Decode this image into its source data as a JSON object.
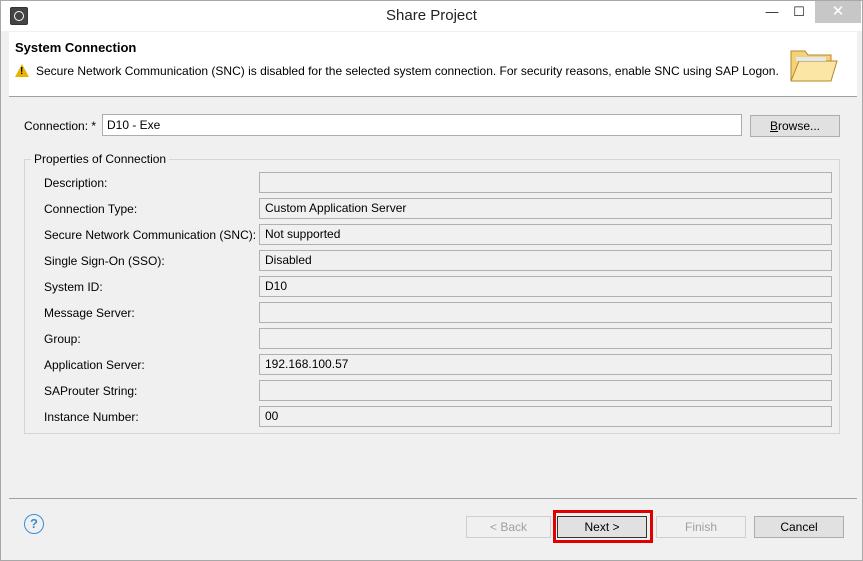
{
  "window": {
    "title": "Share Project",
    "minimize": "—",
    "maximize": "☐",
    "close": "✕"
  },
  "banner": {
    "title": "System Connection",
    "message": "Secure Network Communication (SNC) is disabled for the selected system connection. For security reasons, enable SNC using SAP Logon.",
    "warning_icon": "warning-icon",
    "image_icon": "open-folder-icon"
  },
  "connection": {
    "label": "Connection: *",
    "value": "D10 - Exe",
    "browse_label": "Browse..."
  },
  "properties": {
    "group_title": "Properties of Connection",
    "rows": [
      {
        "label": "Description:",
        "value": ""
      },
      {
        "label": "Connection Type:",
        "value": "Custom Application Server"
      },
      {
        "label": "Secure Network Communication (SNC):",
        "value": "Not supported"
      },
      {
        "label": "Single Sign-On (SSO):",
        "value": "Disabled"
      },
      {
        "label": "System ID:",
        "value": "D10"
      },
      {
        "label": "Message Server:",
        "value": ""
      },
      {
        "label": "Group:",
        "value": ""
      },
      {
        "label": "Application Server:",
        "value": "192.168.100.57"
      },
      {
        "label": "SAProuter String:",
        "value": ""
      },
      {
        "label": "Instance Number:",
        "value": "00"
      }
    ]
  },
  "footer": {
    "help_label": "?",
    "back_label": "< Back",
    "next_label": "Next >",
    "finish_label": "Finish",
    "cancel_label": "Cancel",
    "highlight_color": "#e00000"
  }
}
